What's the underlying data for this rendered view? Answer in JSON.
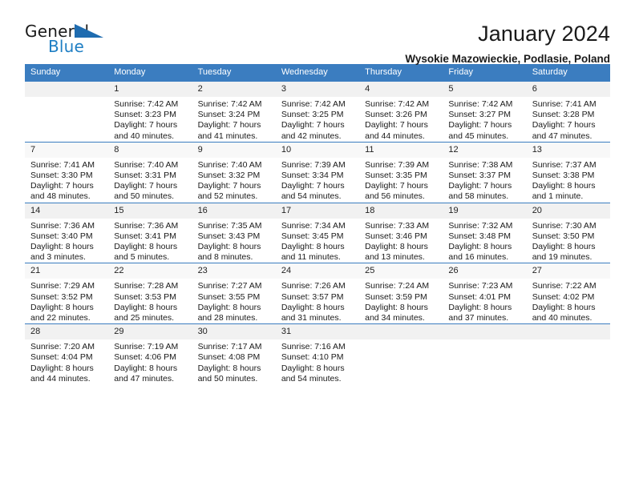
{
  "brand": {
    "name_top": "General",
    "name_bottom": "Blue",
    "triangle_color": "#1f6cb0",
    "blue_color": "#1f7fc4"
  },
  "header": {
    "title": "January 2024",
    "subtitle": "Wysokie Mazowieckie, Podlasie, Poland"
  },
  "theme": {
    "header_bg": "#3b7dc0",
    "daynum_bg": "#f1f1f1",
    "border": "#3b7dc0"
  },
  "weekdays": [
    "Sunday",
    "Monday",
    "Tuesday",
    "Wednesday",
    "Thursday",
    "Friday",
    "Saturday"
  ],
  "weeks": [
    [
      {
        "day": "",
        "lines": []
      },
      {
        "day": "1",
        "lines": [
          "Sunrise: 7:42 AM",
          "Sunset: 3:23 PM",
          "Daylight: 7 hours",
          "and 40 minutes."
        ]
      },
      {
        "day": "2",
        "lines": [
          "Sunrise: 7:42 AM",
          "Sunset: 3:24 PM",
          "Daylight: 7 hours",
          "and 41 minutes."
        ]
      },
      {
        "day": "3",
        "lines": [
          "Sunrise: 7:42 AM",
          "Sunset: 3:25 PM",
          "Daylight: 7 hours",
          "and 42 minutes."
        ]
      },
      {
        "day": "4",
        "lines": [
          "Sunrise: 7:42 AM",
          "Sunset: 3:26 PM",
          "Daylight: 7 hours",
          "and 44 minutes."
        ]
      },
      {
        "day": "5",
        "lines": [
          "Sunrise: 7:42 AM",
          "Sunset: 3:27 PM",
          "Daylight: 7 hours",
          "and 45 minutes."
        ]
      },
      {
        "day": "6",
        "lines": [
          "Sunrise: 7:41 AM",
          "Sunset: 3:28 PM",
          "Daylight: 7 hours",
          "and 47 minutes."
        ]
      }
    ],
    [
      {
        "day": "7",
        "lines": [
          "Sunrise: 7:41 AM",
          "Sunset: 3:30 PM",
          "Daylight: 7 hours",
          "and 48 minutes."
        ]
      },
      {
        "day": "8",
        "lines": [
          "Sunrise: 7:40 AM",
          "Sunset: 3:31 PM",
          "Daylight: 7 hours",
          "and 50 minutes."
        ]
      },
      {
        "day": "9",
        "lines": [
          "Sunrise: 7:40 AM",
          "Sunset: 3:32 PM",
          "Daylight: 7 hours",
          "and 52 minutes."
        ]
      },
      {
        "day": "10",
        "lines": [
          "Sunrise: 7:39 AM",
          "Sunset: 3:34 PM",
          "Daylight: 7 hours",
          "and 54 minutes."
        ]
      },
      {
        "day": "11",
        "lines": [
          "Sunrise: 7:39 AM",
          "Sunset: 3:35 PM",
          "Daylight: 7 hours",
          "and 56 minutes."
        ]
      },
      {
        "day": "12",
        "lines": [
          "Sunrise: 7:38 AM",
          "Sunset: 3:37 PM",
          "Daylight: 7 hours",
          "and 58 minutes."
        ]
      },
      {
        "day": "13",
        "lines": [
          "Sunrise: 7:37 AM",
          "Sunset: 3:38 PM",
          "Daylight: 8 hours",
          "and 1 minute."
        ]
      }
    ],
    [
      {
        "day": "14",
        "lines": [
          "Sunrise: 7:36 AM",
          "Sunset: 3:40 PM",
          "Daylight: 8 hours",
          "and 3 minutes."
        ]
      },
      {
        "day": "15",
        "lines": [
          "Sunrise: 7:36 AM",
          "Sunset: 3:41 PM",
          "Daylight: 8 hours",
          "and 5 minutes."
        ]
      },
      {
        "day": "16",
        "lines": [
          "Sunrise: 7:35 AM",
          "Sunset: 3:43 PM",
          "Daylight: 8 hours",
          "and 8 minutes."
        ]
      },
      {
        "day": "17",
        "lines": [
          "Sunrise: 7:34 AM",
          "Sunset: 3:45 PM",
          "Daylight: 8 hours",
          "and 11 minutes."
        ]
      },
      {
        "day": "18",
        "lines": [
          "Sunrise: 7:33 AM",
          "Sunset: 3:46 PM",
          "Daylight: 8 hours",
          "and 13 minutes."
        ]
      },
      {
        "day": "19",
        "lines": [
          "Sunrise: 7:32 AM",
          "Sunset: 3:48 PM",
          "Daylight: 8 hours",
          "and 16 minutes."
        ]
      },
      {
        "day": "20",
        "lines": [
          "Sunrise: 7:30 AM",
          "Sunset: 3:50 PM",
          "Daylight: 8 hours",
          "and 19 minutes."
        ]
      }
    ],
    [
      {
        "day": "21",
        "lines": [
          "Sunrise: 7:29 AM",
          "Sunset: 3:52 PM",
          "Daylight: 8 hours",
          "and 22 minutes."
        ]
      },
      {
        "day": "22",
        "lines": [
          "Sunrise: 7:28 AM",
          "Sunset: 3:53 PM",
          "Daylight: 8 hours",
          "and 25 minutes."
        ]
      },
      {
        "day": "23",
        "lines": [
          "Sunrise: 7:27 AM",
          "Sunset: 3:55 PM",
          "Daylight: 8 hours",
          "and 28 minutes."
        ]
      },
      {
        "day": "24",
        "lines": [
          "Sunrise: 7:26 AM",
          "Sunset: 3:57 PM",
          "Daylight: 8 hours",
          "and 31 minutes."
        ]
      },
      {
        "day": "25",
        "lines": [
          "Sunrise: 7:24 AM",
          "Sunset: 3:59 PM",
          "Daylight: 8 hours",
          "and 34 minutes."
        ]
      },
      {
        "day": "26",
        "lines": [
          "Sunrise: 7:23 AM",
          "Sunset: 4:01 PM",
          "Daylight: 8 hours",
          "and 37 minutes."
        ]
      },
      {
        "day": "27",
        "lines": [
          "Sunrise: 7:22 AM",
          "Sunset: 4:02 PM",
          "Daylight: 8 hours",
          "and 40 minutes."
        ]
      }
    ],
    [
      {
        "day": "28",
        "lines": [
          "Sunrise: 7:20 AM",
          "Sunset: 4:04 PM",
          "Daylight: 8 hours",
          "and 44 minutes."
        ]
      },
      {
        "day": "29",
        "lines": [
          "Sunrise: 7:19 AM",
          "Sunset: 4:06 PM",
          "Daylight: 8 hours",
          "and 47 minutes."
        ]
      },
      {
        "day": "30",
        "lines": [
          "Sunrise: 7:17 AM",
          "Sunset: 4:08 PM",
          "Daylight: 8 hours",
          "and 50 minutes."
        ]
      },
      {
        "day": "31",
        "lines": [
          "Sunrise: 7:16 AM",
          "Sunset: 4:10 PM",
          "Daylight: 8 hours",
          "and 54 minutes."
        ]
      },
      {
        "day": "",
        "lines": []
      },
      {
        "day": "",
        "lines": []
      },
      {
        "day": "",
        "lines": []
      }
    ]
  ]
}
